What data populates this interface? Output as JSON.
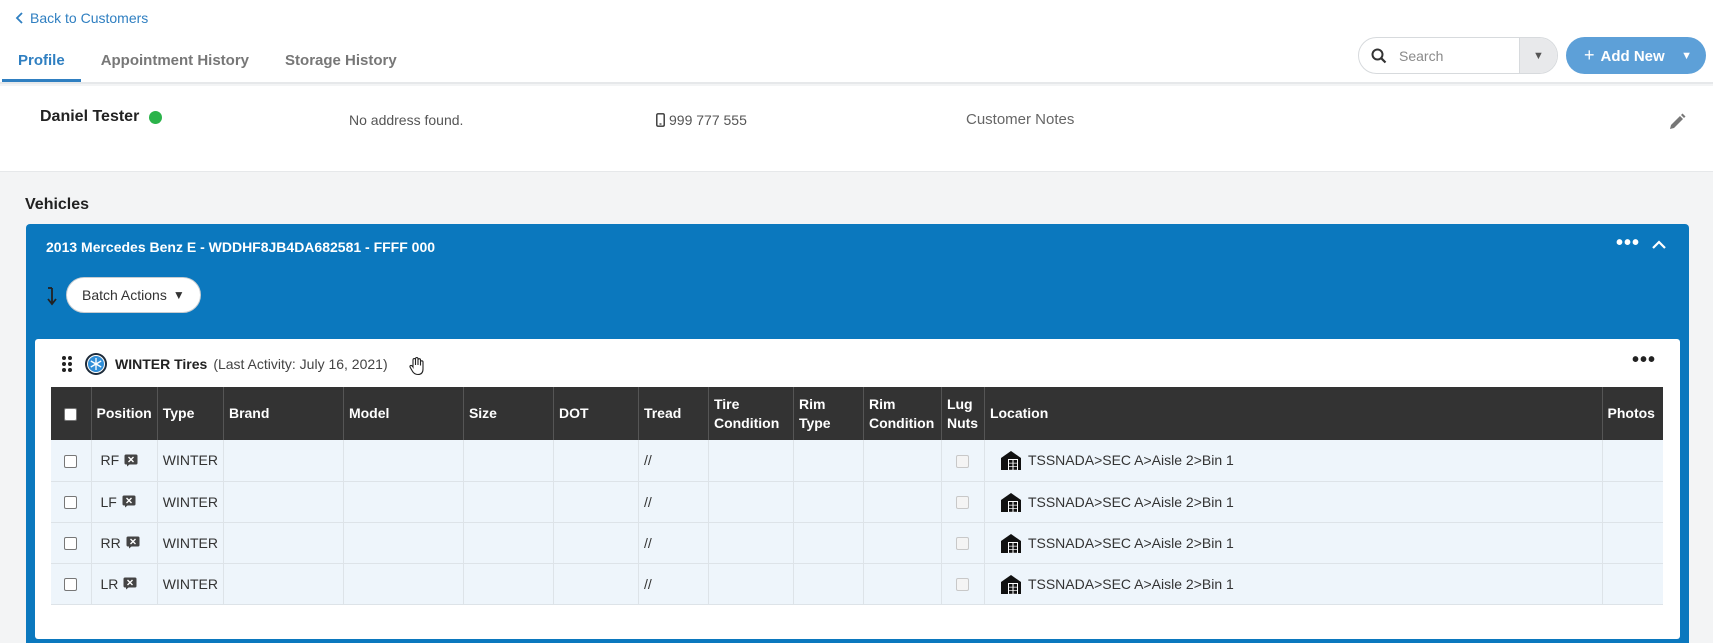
{
  "nav": {
    "back_label": "Back to Customers"
  },
  "tabs": [
    {
      "label": "Profile",
      "active": true
    },
    {
      "label": "Appointment History",
      "active": false
    },
    {
      "label": "Storage History",
      "active": false
    }
  ],
  "search": {
    "placeholder": "Search"
  },
  "add_new": {
    "label": "Add New"
  },
  "customer": {
    "name": "Daniel Tester",
    "status_color": "#2bb34a",
    "address": "No address found.",
    "phone": "999 777 555",
    "notes_label": "Customer Notes"
  },
  "vehicles": {
    "title": "Vehicles",
    "vehicle_title": "2013 Mercedes Benz E - WDDHF8JB4DA682581 - FFFF 000",
    "batch_actions_label": "Batch Actions",
    "tire_set": {
      "name": "WINTER Tires",
      "last_activity": "(Last Activity: July 16, 2021)",
      "columns": [
        "Position",
        "Type",
        "Brand",
        "Model",
        "Size",
        "DOT",
        "Tread",
        "Tire Condition",
        "Rim Type",
        "Rim Condition",
        "Lug Nuts",
        "Location",
        "Photos"
      ],
      "rows": [
        {
          "position": "RF",
          "type": "WINTER",
          "brand": "",
          "model": "",
          "size": "",
          "dot": "",
          "tread": "//",
          "tire_condition": "",
          "rim_type": "",
          "rim_condition": "",
          "location": "TSSNADA>SEC A>Aisle 2>Bin 1",
          "photos": ""
        },
        {
          "position": "LF",
          "type": "WINTER",
          "brand": "",
          "model": "",
          "size": "",
          "dot": "",
          "tread": "//",
          "tire_condition": "",
          "rim_type": "",
          "rim_condition": "",
          "location": "TSSNADA>SEC A>Aisle 2>Bin 1",
          "photos": ""
        },
        {
          "position": "RR",
          "type": "WINTER",
          "brand": "",
          "model": "",
          "size": "",
          "dot": "",
          "tread": "//",
          "tire_condition": "",
          "rim_type": "",
          "rim_condition": "",
          "location": "TSSNADA>SEC A>Aisle 2>Bin 1",
          "photos": ""
        },
        {
          "position": "LR",
          "type": "WINTER",
          "brand": "",
          "model": "",
          "size": "",
          "dot": "",
          "tread": "//",
          "tire_condition": "",
          "rim_type": "",
          "rim_condition": "",
          "location": "TSSNADA>SEC A>Aisle 2>Bin 1",
          "photos": ""
        }
      ]
    }
  },
  "colors": {
    "accent": "#2f7fc1",
    "vehicle_panel": "#0b78be",
    "add_button": "#5da0d8",
    "table_header": "#333333",
    "row_bg": "#eef5fb"
  },
  "icons": [
    "chevron-left-icon",
    "search-icon",
    "caret-down-icon",
    "plus-icon",
    "phone-icon",
    "pencil-icon",
    "more-icon",
    "chevron-up-icon",
    "sort-icon",
    "drag-handle-icon",
    "snowflake-icon",
    "hand-cursor-icon",
    "remove-tire-icon",
    "warehouse-icon"
  ]
}
